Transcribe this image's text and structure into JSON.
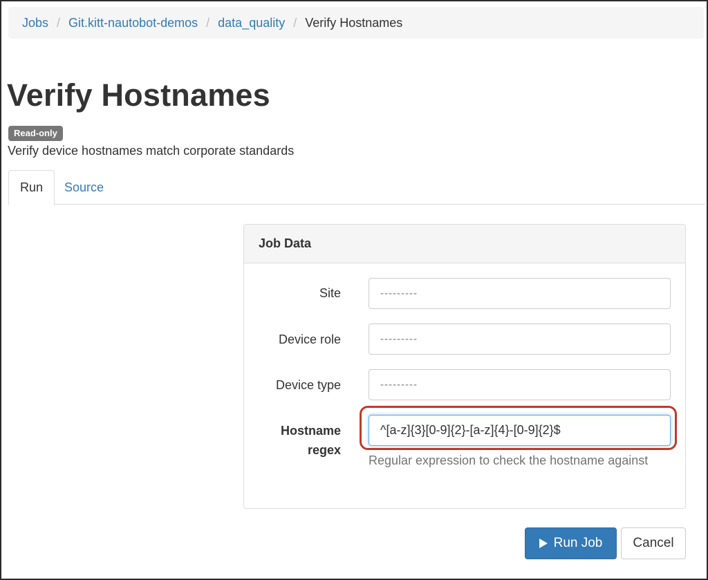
{
  "breadcrumb": {
    "items": [
      {
        "label": "Jobs",
        "link": true
      },
      {
        "label": "Git.kitt-nautobot-demos",
        "link": true
      },
      {
        "label": "data_quality",
        "link": true
      },
      {
        "label": "Verify Hostnames",
        "link": false
      }
    ],
    "separator": "/"
  },
  "page": {
    "title": "Verify Hostnames",
    "badge": "Read-only",
    "description": "Verify device hostnames match corporate standards"
  },
  "tabs": [
    {
      "label": "Run",
      "active": true
    },
    {
      "label": "Source",
      "active": false
    }
  ],
  "form": {
    "heading": "Job Data",
    "fields": {
      "site": {
        "label": "Site",
        "value": "---------"
      },
      "device_role": {
        "label": "Device role",
        "value": "---------"
      },
      "device_type": {
        "label": "Device type",
        "value": "---------"
      },
      "hostname_regex": {
        "label_line1": "Hostname",
        "label_line2": "regex",
        "value": "^[a-z]{3}[0-9]{2}-[a-z]{4}-[0-9]{2}$",
        "help": "Regular expression to check the hostname against"
      }
    }
  },
  "buttons": {
    "run_icon": "play-icon",
    "run_label": "Run Job",
    "cancel_label": "Cancel"
  },
  "colors": {
    "link": "#337ab7",
    "primary": "#337ab7",
    "badge": "#777777",
    "highlight": "#c0392b"
  }
}
